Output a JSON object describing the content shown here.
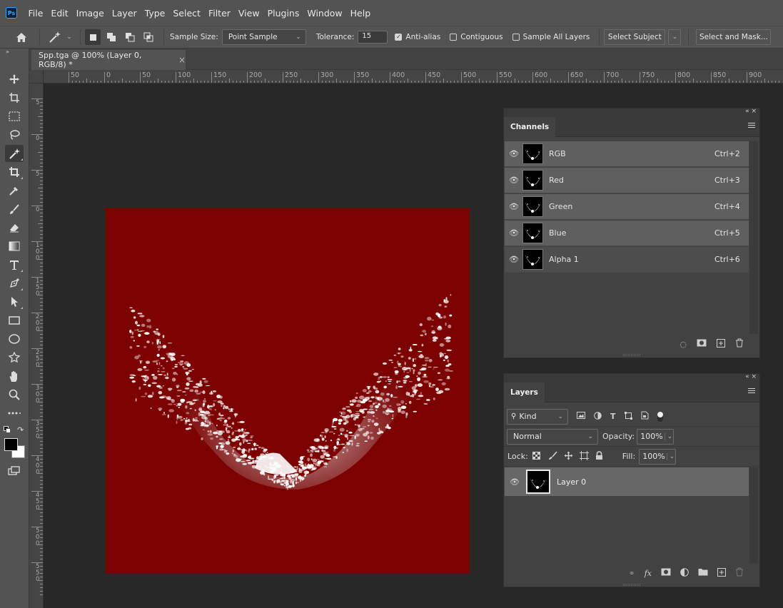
{
  "app": {
    "logo": "Ps"
  },
  "menu": [
    "File",
    "Edit",
    "Image",
    "Layer",
    "Type",
    "Select",
    "Filter",
    "View",
    "Plugins",
    "Window",
    "Help"
  ],
  "options": {
    "sample_size_label": "Sample Size:",
    "sample_size_value": "Point Sample",
    "tolerance_label": "Tolerance:",
    "tolerance_value": "15",
    "anti_alias_label": "Anti-alias",
    "anti_alias_checked": true,
    "contiguous_label": "Contiguous",
    "contiguous_checked": false,
    "sample_all_layers_label": "Sample All Layers",
    "sample_all_layers_checked": false,
    "select_subject_label": "Select Subject",
    "select_and_mask_label": "Select and Mask..."
  },
  "document": {
    "tab_title": "Spp.tga @ 100% (Layer 0, RGB/8) *",
    "canvas_color": "#7c0202"
  },
  "ruler": {
    "h_labels": [
      "50",
      "0",
      "50",
      "100",
      "150",
      "200",
      "250",
      "300",
      "350",
      "400",
      "450",
      "500",
      "550",
      "600",
      "650",
      "700",
      "750",
      "800",
      "850",
      "900"
    ],
    "v_labels": [
      "5",
      "0",
      "5",
      "0",
      "1 0 0",
      "1 5 0",
      "2 0 0",
      "2 5 0",
      "3 0 0",
      "3 5 0",
      "4 0 0",
      "4 5 0",
      "5 0 0",
      "5 5 0"
    ]
  },
  "channels_panel": {
    "title": "Channels",
    "rows": [
      {
        "name": "RGB",
        "shortcut": "Ctrl+2"
      },
      {
        "name": "Red",
        "shortcut": "Ctrl+3"
      },
      {
        "name": "Green",
        "shortcut": "Ctrl+4"
      },
      {
        "name": "Blue",
        "shortcut": "Ctrl+5"
      },
      {
        "name": "Alpha 1",
        "shortcut": "Ctrl+6"
      }
    ]
  },
  "layers_panel": {
    "title": "Layers",
    "filter_kind": "Kind",
    "blend_mode": "Normal",
    "opacity_label": "Opacity:",
    "opacity_value": "100%",
    "lock_label": "Lock:",
    "fill_label": "Fill:",
    "fill_value": "100%",
    "layers": [
      {
        "name": "Layer 0"
      }
    ],
    "footer_fx": "fx"
  },
  "colors": {
    "foreground": "#000000",
    "background": "#ffffff",
    "accent": "#31a8ff"
  }
}
